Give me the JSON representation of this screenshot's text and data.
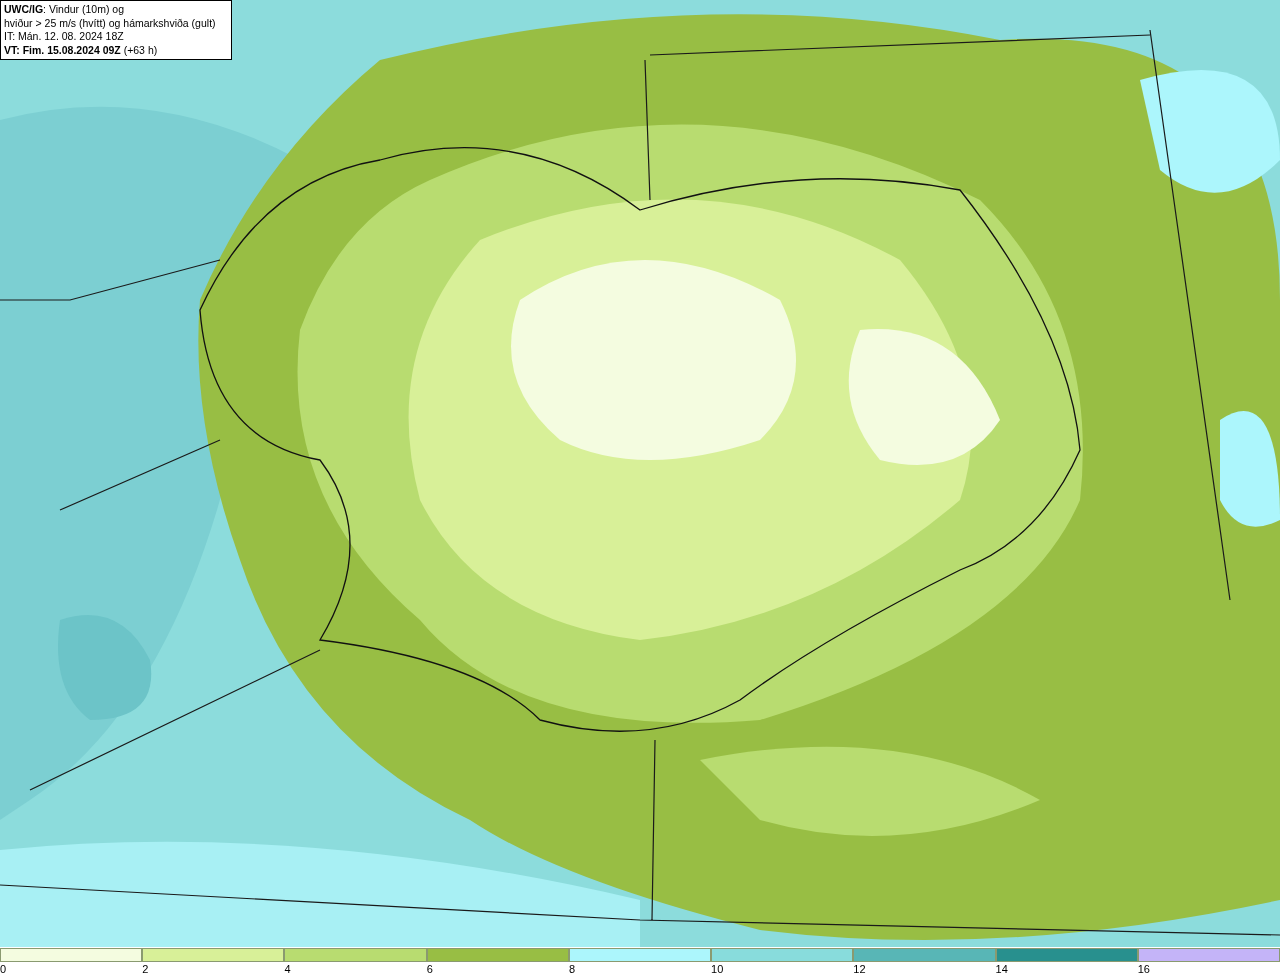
{
  "title_box": {
    "lines": [
      {
        "text": "**UWC/IG**: Vindur (10m) og"
      },
      {
        "text": "hviður > 25 m/s (hvítt) og hámarkshviða (gult)"
      },
      {
        "text": "IT: Mán. 12. 08. 2024 18Z"
      },
      {
        "text": "**VT: Fim. 15.08.2024 09Z** (+63 h)"
      }
    ]
  },
  "legend": [
    {
      "label": "0",
      "color": "#f4fce0"
    },
    {
      "label": "2",
      "color": "#d8f098"
    },
    {
      "label": "4",
      "color": "#b8dc70"
    },
    {
      "label": "6",
      "color": "#98be44"
    },
    {
      "label": "8",
      "color": "#acf6fc"
    },
    {
      "label": "10",
      "color": "#88dcdc"
    },
    {
      "label": "12",
      "color": "#58b6b6"
    },
    {
      "label": "14",
      "color": "#28908e"
    },
    {
      "label": "16",
      "color": "#c4b4f8"
    }
  ]
}
